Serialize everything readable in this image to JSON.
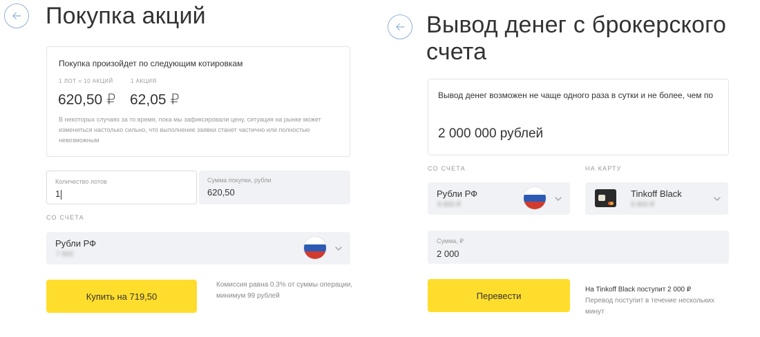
{
  "colors": {
    "accent": "#ffdd2d",
    "field_bg": "#f0f2f5",
    "back_ring": "#8fb1d6"
  },
  "left": {
    "back_icon": "arrow-left-icon",
    "title": "Покупка акций",
    "quote_card": {
      "heading": "Покупка произойдет по следующим котировкам",
      "lot_label": "1 ЛОТ = 10 АКЦИЙ",
      "share_label": "1 АКЦИЯ",
      "lot_price": "620,50 ₽",
      "share_price": "62,05 ₽",
      "disclaimer": "В некоторых случаях за то время, пока мы зафиксировали цену, ситуация на рынке может измениться настолько сильно, что выполнение заявки станет частично или полностью невозможным"
    },
    "lots": {
      "label": "Количество лотов",
      "value": "1"
    },
    "sum": {
      "label": "Сумма покупки, рубли",
      "value": "620,50"
    },
    "from_account_label": "СО СЧЕТА",
    "account": {
      "name": "Рубли РФ",
      "masked": "7 500"
    },
    "buy_button": "Купить на 719,50",
    "commission_note": "Комиссия равна 0.3% от суммы операции, минимум 99 рублей"
  },
  "right": {
    "back_icon": "arrow-left-icon",
    "title_line1": "Вывод денег с брокерского",
    "title_line2": "счета",
    "info_card": {
      "text": "Вывод денег возможен не чаще одного раза в сутки и не более, чем по",
      "limit": "2 000 000 рублей"
    },
    "from_account_label": "СО СЧЕТА",
    "to_card_label": "НА КАРТУ",
    "account": {
      "name": "Рубли РФ",
      "masked": "9 800 ₽"
    },
    "card": {
      "name": "Tinkoff Black",
      "masked": "9 800 ₽"
    },
    "amount": {
      "label": "Сумма, ₽",
      "value": "2 000"
    },
    "transfer_button": "Перевести",
    "receive_note": "На Tinkoff Black поступит 2 000 ₽",
    "time_note": "Перевод поступит в течение нескольких минут"
  }
}
